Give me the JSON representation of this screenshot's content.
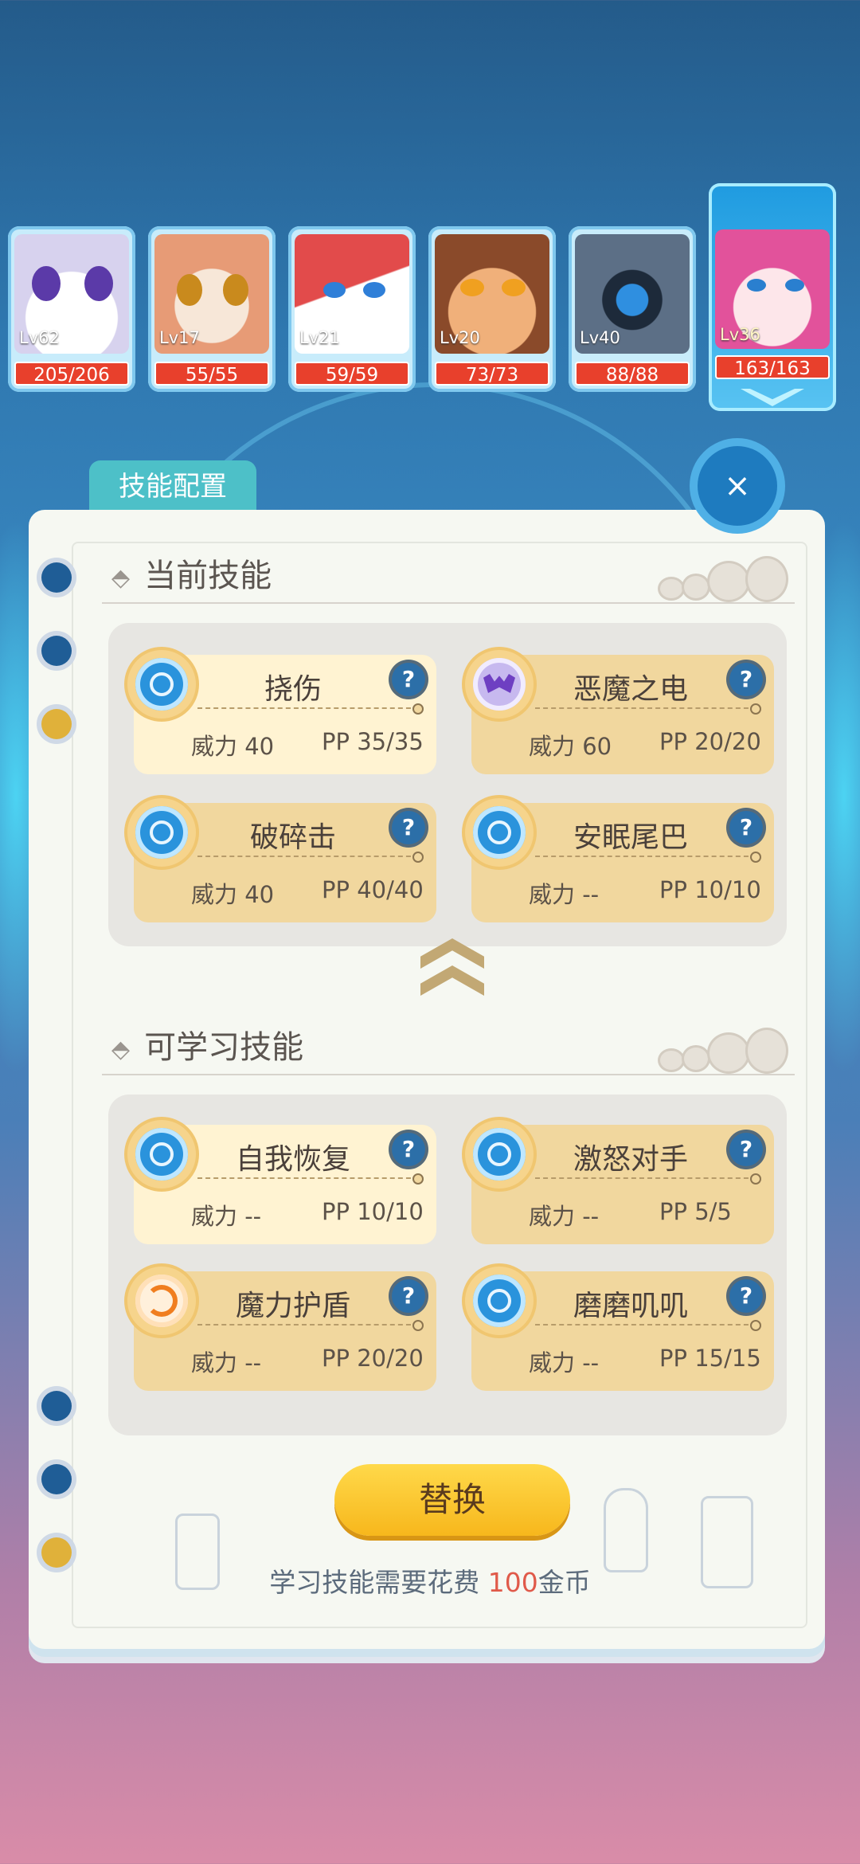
{
  "team": [
    {
      "level": "Lv62",
      "hp": "205/206"
    },
    {
      "level": "Lv17",
      "hp": "55/55"
    },
    {
      "level": "Lv21",
      "hp": "59/59"
    },
    {
      "level": "Lv20",
      "hp": "73/73"
    },
    {
      "level": "Lv40",
      "hp": "88/88"
    },
    {
      "level": "Lv36",
      "hp": "163/163",
      "selected": true
    }
  ],
  "panel": {
    "tab_label": "技能配置",
    "close_icon": "×",
    "current_title": "当前技能",
    "learnable_title": "可学习技能",
    "section_marker": "⬘",
    "collapse_icon": "double-chevron-up-icon"
  },
  "current_skills": [
    {
      "name": "挠伤",
      "power": "威力 40",
      "pp": "PP 35/35",
      "icon": "water-icon",
      "highlight": true
    },
    {
      "name": "恶魔之电",
      "power": "威力 60",
      "pp": "PP 20/20",
      "icon": "bat-icon"
    },
    {
      "name": "破碎击",
      "power": "威力 40",
      "pp": "PP 40/40",
      "icon": "water-icon"
    },
    {
      "name": "安眠尾巴",
      "power": "威力 --",
      "pp": "PP 10/10",
      "icon": "water-icon"
    }
  ],
  "learnable_skills": [
    {
      "name": "自我恢复",
      "power": "威力 --",
      "pp": "PP 10/10",
      "icon": "water-icon",
      "highlight": true
    },
    {
      "name": "激怒对手",
      "power": "威力 --",
      "pp": "PP 5/5",
      "icon": "water-icon"
    },
    {
      "name": "魔力护盾",
      "power": "威力 --",
      "pp": "PP 20/20",
      "icon": "swirl-icon"
    },
    {
      "name": "磨磨叽叽",
      "power": "威力 --",
      "pp": "PP 15/15",
      "icon": "water-icon"
    }
  ],
  "help_icon": "?",
  "replace_button": "替换",
  "cost": {
    "prefix": "学习技能需要花费 ",
    "amount": "100",
    "suffix": "金币"
  },
  "colors": {
    "accent": "#4dc0c8",
    "button": "#f7b71c",
    "hp_bar": "#e8402c",
    "cost_amount": "#e05a4a"
  }
}
